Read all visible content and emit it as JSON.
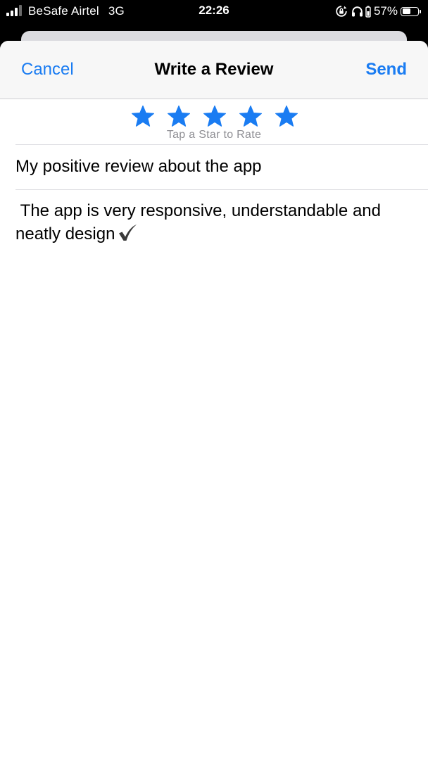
{
  "status_bar": {
    "carrier": "BeSafe Airtel",
    "network": "3G",
    "time": "22:26",
    "battery_percent": "57%",
    "battery_level": 0.57,
    "icons": [
      "signal-bars-icon",
      "orientation-lock-icon",
      "headphones-icon",
      "battery-icon"
    ]
  },
  "nav": {
    "cancel_label": "Cancel",
    "title": "Write a Review",
    "send_label": "Send",
    "accent_color": "#1a7cf2"
  },
  "rating": {
    "stars_total": 5,
    "stars_selected": 5,
    "hint": "Tap a Star to Rate",
    "star_color": "#1a7cf2"
  },
  "review": {
    "title_value": "My positive review about the app",
    "body_value": " The app is very responsive, understandable and neatly design",
    "body_trailing_icon": "checkmark-icon"
  }
}
